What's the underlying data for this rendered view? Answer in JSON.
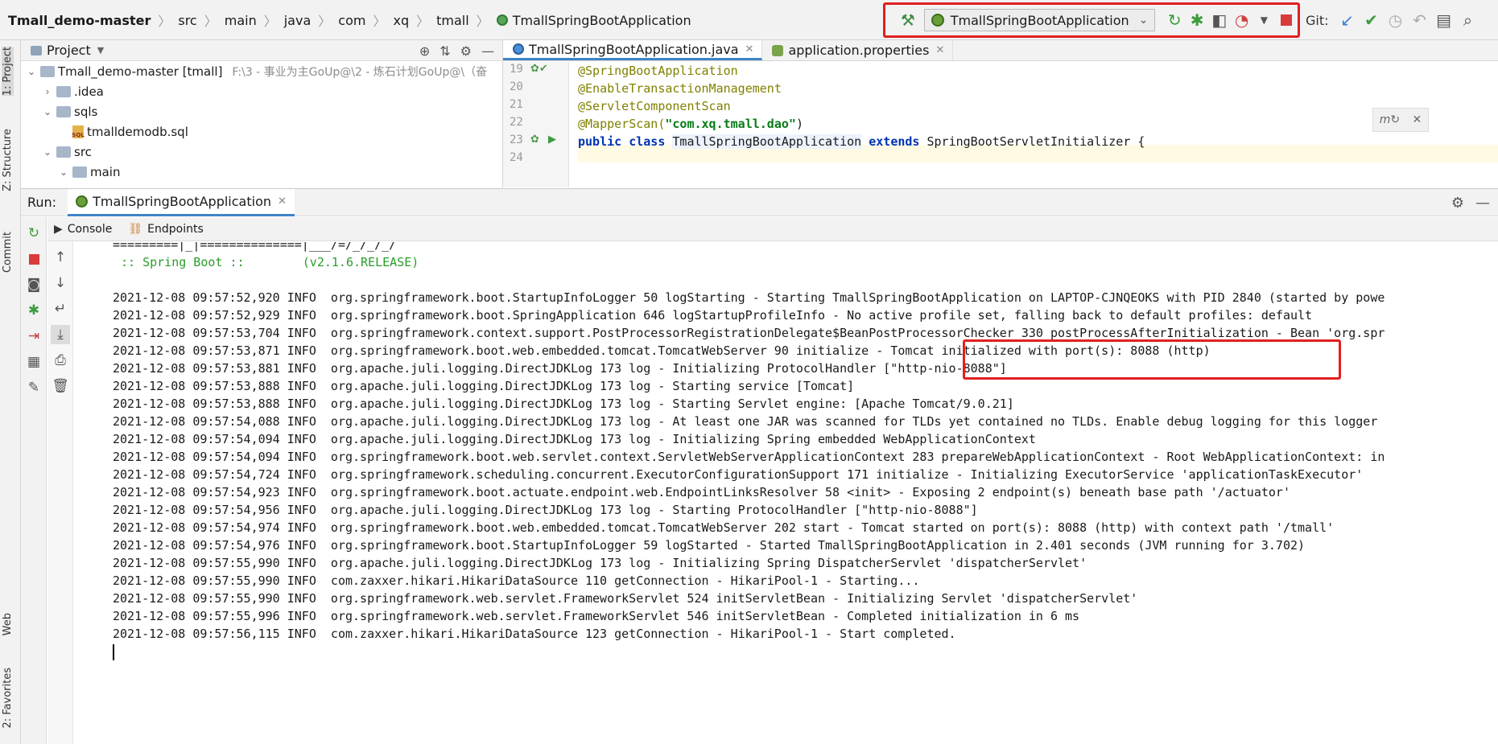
{
  "breadcrumb": [
    "Tmall_demo-master",
    "src",
    "main",
    "java",
    "com",
    "xq",
    "tmall",
    "TmallSpringBootApplication"
  ],
  "toolbar": {
    "build_icon": "hammer-icon",
    "run_config_label": "TmallSpringBootApplication",
    "icons": [
      "rerun-icon",
      "debug-icon",
      "coverage-icon",
      "profile-icon",
      "stop-icon"
    ]
  },
  "git": {
    "label": "Git:",
    "icons": [
      "update-icon",
      "commit-check-icon",
      "history-icon",
      "rollback-icon",
      "branches-icon"
    ]
  },
  "left_tabs": [
    "1: Project",
    "Z: Structure",
    "Commit",
    "Web",
    "2: Favorites"
  ],
  "project": {
    "title": "Project",
    "tree": [
      {
        "label": "Tmall_demo-master [tmall]",
        "hint": "F:\\3 - 事业为主GoUp@\\2 - 炼石计划GoUp@\\（奋"
      },
      {
        "label": ".idea"
      },
      {
        "label": "sqls"
      },
      {
        "label": "tmalldemodb.sql"
      },
      {
        "label": "src"
      },
      {
        "label": "main"
      }
    ]
  },
  "editor": {
    "tabs": [
      "TmallSpringBootApplication.java",
      "application.properties"
    ],
    "line_numbers": [
      "19",
      "20",
      "21",
      "22",
      "23",
      "24"
    ],
    "code": {
      "l19": "@SpringBootApplication",
      "l20": "@EnableTransactionManagement",
      "l21": "@ServletComponentScan",
      "l22_ann": "@MapperScan(",
      "l22_str": "\"com.xq.tmall.dao\"",
      "l22_end": ")",
      "l23_kw1": "public class ",
      "l23_cls": "TmallSpringBootApplication",
      "l23_kw2": " extends ",
      "l23_rest": "SpringBootServletInitializer {"
    }
  },
  "run": {
    "label": "Run:",
    "tab": "TmallSpringBootApplication",
    "console_tabs": [
      "Console",
      "Endpoints"
    ],
    "log_lines": [
      "=========|_|==============|___/=/_/_/_/",
      ":: Spring Boot ::        (v2.1.6.RELEASE)",
      "2021-12-08 09:57:52,920 INFO  org.springframework.boot.StartupInfoLogger 50 logStarting - Starting TmallSpringBootApplication on LAPTOP-CJNQEOKS with PID 2840 (started by powe",
      "2021-12-08 09:57:52,929 INFO  org.springframework.boot.SpringApplication 646 logStartupProfileInfo - No active profile set, falling back to default profiles: default",
      "2021-12-08 09:57:53,704 INFO  org.springframework.context.support.PostProcessorRegistrationDelegate$BeanPostProcessorChecker 330 postProcessAfterInitialization - Bean 'org.spr",
      "2021-12-08 09:57:53,871 INFO  org.springframework.boot.web.embedded.tomcat.TomcatWebServer 90 initialize - Tomcat initialized with port(s): 8088 (http)",
      "2021-12-08 09:57:53,881 INFO  org.apache.juli.logging.DirectJDKLog 173 log - Initializing ProtocolHandler [\"http-nio-8088\"]",
      "2021-12-08 09:57:53,888 INFO  org.apache.juli.logging.DirectJDKLog 173 log - Starting service [Tomcat]",
      "2021-12-08 09:57:53,888 INFO  org.apache.juli.logging.DirectJDKLog 173 log - Starting Servlet engine: [Apache Tomcat/9.0.21]",
      "2021-12-08 09:57:54,088 INFO  org.apache.juli.logging.DirectJDKLog 173 log - At least one JAR was scanned for TLDs yet contained no TLDs. Enable debug logging for this logger",
      "2021-12-08 09:57:54,094 INFO  org.apache.juli.logging.DirectJDKLog 173 log - Initializing Spring embedded WebApplicationContext",
      "2021-12-08 09:57:54,094 INFO  org.springframework.boot.web.servlet.context.ServletWebServerApplicationContext 283 prepareWebApplicationContext - Root WebApplicationContext: in",
      "2021-12-08 09:57:54,724 INFO  org.springframework.scheduling.concurrent.ExecutorConfigurationSupport 171 initialize - Initializing ExecutorService 'applicationTaskExecutor'",
      "2021-12-08 09:57:54,923 INFO  org.springframework.boot.actuate.endpoint.web.EndpointLinksResolver 58 <init> - Exposing 2 endpoint(s) beneath base path '/actuator'",
      "2021-12-08 09:57:54,956 INFO  org.apache.juli.logging.DirectJDKLog 173 log - Starting ProtocolHandler [\"http-nio-8088\"]",
      "2021-12-08 09:57:54,974 INFO  org.springframework.boot.web.embedded.tomcat.TomcatWebServer 202 start - Tomcat started on port(s): 8088 (http) with context path '/tmall'",
      "2021-12-08 09:57:54,976 INFO  org.springframework.boot.StartupInfoLogger 59 logStarted - Started TmallSpringBootApplication in 2.401 seconds (JVM running for 3.702)",
      "2021-12-08 09:57:55,990 INFO  org.apache.juli.logging.DirectJDKLog 173 log - Initializing Spring DispatcherServlet 'dispatcherServlet'",
      "2021-12-08 09:57:55,990 INFO  com.zaxxer.hikari.HikariDataSource 110 getConnection - HikariPool-1 - Starting...",
      "2021-12-08 09:57:55,990 INFO  org.springframework.web.servlet.FrameworkServlet 524 initServletBean - Initializing Servlet 'dispatcherServlet'",
      "2021-12-08 09:57:55,996 INFO  org.springframework.web.servlet.FrameworkServlet 546 initServletBean - Completed initialization in 6 ms",
      "2021-12-08 09:57:56,115 INFO  com.zaxxer.hikari.HikariDataSource 123 getConnection - HikariPool-1 - Start completed."
    ]
  },
  "colors": {
    "highlight_box": "#e02020",
    "spring_green": "#2a9d2a",
    "annotation": "#808000",
    "keyword": "#0033b3"
  }
}
